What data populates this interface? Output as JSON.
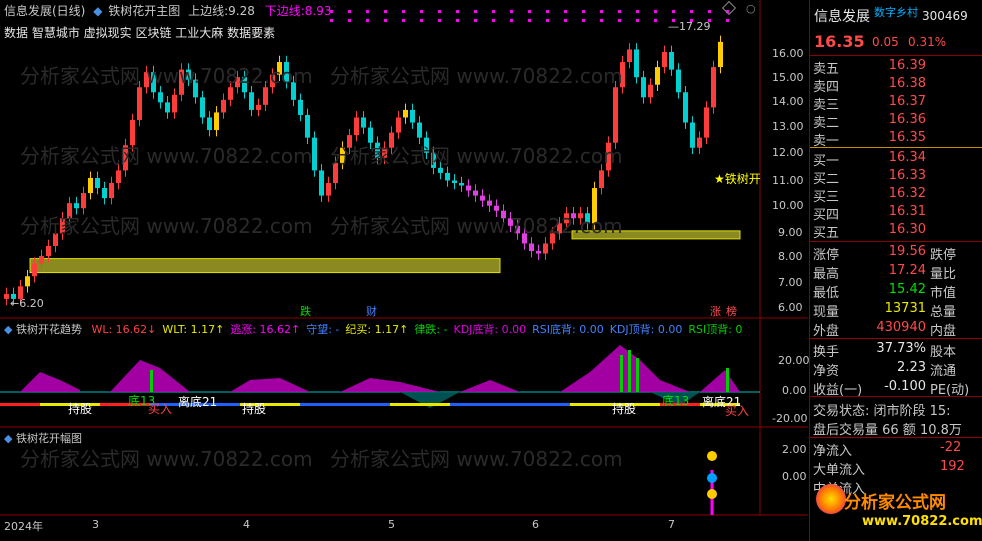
{
  "title_bar": {
    "stock_period": "信息发展(日线)",
    "indicator": "铁树花开主图",
    "upper_label": "上边线:",
    "upper_value": "9.28",
    "lower_label": "下边线:",
    "lower_value": "8.93"
  },
  "tags_line": "数据 智慧城市 虚拟现实 区块链 工业大麻 数据要素",
  "watermark": "分析家公式网 www.70822.com",
  "main_chart": {
    "max_label": "17.29",
    "min_label": "6.20",
    "signal_label": "★铁树开",
    "bottom_tags": [
      "跌",
      "财",
      "涨",
      "榜"
    ],
    "price_axis": [
      "16.00",
      "15.00",
      "14.00",
      "13.00",
      "12.00",
      "11.00",
      "10.00",
      "9.00",
      "8.00",
      "7.00",
      "6.00"
    ],
    "colors": {
      "up": "#ff3c3c",
      "down": "#00d0d0",
      "band": "#8a8a20",
      "band_edge": "#e0e000"
    }
  },
  "trend_panel": {
    "title": "铁树开花趋势",
    "items": [
      {
        "label": "WL:",
        "value": "16.62",
        "arrow": "↓",
        "color": "#ff4040"
      },
      {
        "label": "WLT:",
        "value": "1.17",
        "arrow": "↑",
        "color": "#e8e800"
      },
      {
        "label": "逃涨:",
        "value": "16.62",
        "arrow": "↑",
        "color": "#ff00ff"
      },
      {
        "label": "守望:",
        "value": "-",
        "arrow": "",
        "color": "#4080ff"
      },
      {
        "label": "纪买:",
        "value": "1.17",
        "arrow": "↑",
        "color": "#e8e800"
      },
      {
        "label": "律跌:",
        "value": "-",
        "arrow": "",
        "color": "#00d000"
      },
      {
        "label": "KDJ底背:",
        "value": "0.00",
        "arrow": "",
        "color": "#e000e0"
      },
      {
        "label": "RSI底背:",
        "value": "0.00",
        "arrow": "",
        "color": "#4080ff"
      },
      {
        "label": "KDJ顶背:",
        "value": "0.00",
        "arrow": "",
        "color": "#4080ff"
      },
      {
        "label": "RSI顶背:",
        "value": "0",
        "arrow": "",
        "color": "#00d000"
      }
    ],
    "axis": [
      "20.00",
      "0.00",
      "-20.00"
    ],
    "signal_texts": [
      "持股",
      "底13",
      "买入",
      "离底21",
      "持股",
      "持股",
      "底13",
      "离底21",
      "买入"
    ]
  },
  "amp_panel": {
    "title": "铁树花开幅图",
    "axis": [
      "2.00",
      "0.00"
    ]
  },
  "time_axis": {
    "labels": [
      "2024年",
      "3",
      "4",
      "5",
      "6",
      "7"
    ]
  },
  "quote": {
    "name": "信息发展",
    "tag": "数字乡村",
    "code": "300469",
    "price": "16.35",
    "change": "0.05",
    "change_pct": "0.31%",
    "asks": [
      {
        "label": "卖五",
        "price": "16.39"
      },
      {
        "label": "卖四",
        "price": "16.38"
      },
      {
        "label": "卖三",
        "price": "16.37"
      },
      {
        "label": "卖二",
        "price": "16.36"
      },
      {
        "label": "卖一",
        "price": "16.35"
      }
    ],
    "bids": [
      {
        "label": "买一",
        "price": "16.34"
      },
      {
        "label": "买二",
        "price": "16.33"
      },
      {
        "label": "买三",
        "price": "16.32"
      },
      {
        "label": "买四",
        "price": "16.31"
      },
      {
        "label": "买五",
        "price": "16.30"
      }
    ],
    "stats": [
      {
        "l1": "涨停",
        "v": "19.56",
        "l2": "跌停",
        "color": "red"
      },
      {
        "l1": "最高",
        "v": "17.24",
        "l2": "量比",
        "color": "red"
      },
      {
        "l1": "最低",
        "v": "15.42",
        "l2": "市值",
        "color": "green"
      },
      {
        "l1": "现量",
        "v": "13731",
        "l2": "总量",
        "color": "yellow"
      },
      {
        "l1": "外盘",
        "v": "430940",
        "l2": "内盘",
        "color": "red"
      }
    ],
    "stats2": [
      {
        "l1": "换手",
        "v": "37.73%",
        "l2": "股本",
        "color": "white"
      },
      {
        "l1": "净资",
        "v": "2.23",
        "l2": "流通",
        "color": "white"
      },
      {
        "l1": "收益(一)",
        "v": "-0.100",
        "l2": "PE(动)",
        "color": "white"
      }
    ],
    "trade_status": "交易状态: 闭市阶段 15:",
    "after_hours": "盘后交易量 66 额 10.8万",
    "flows": [
      {
        "label": "净流入",
        "value": "-22"
      },
      {
        "label": "大单流入",
        "value": "192"
      },
      {
        "label": "中单流入",
        "value": ""
      }
    ]
  },
  "logo": {
    "text": "分析家公式网",
    "url": "www.70822.com"
  }
}
